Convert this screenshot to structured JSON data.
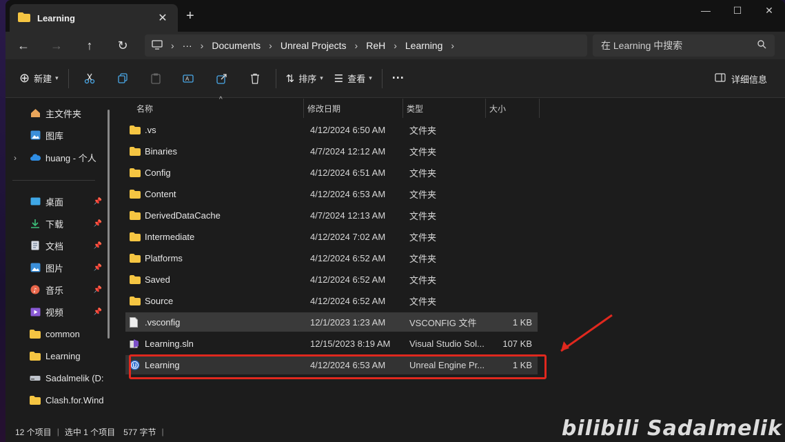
{
  "tab": {
    "title": "Learning"
  },
  "window_controls": {
    "minimize": "—",
    "maximize": "☐",
    "close": "✕"
  },
  "breadcrumb": [
    "Documents",
    "Unreal Projects",
    "ReH",
    "Learning"
  ],
  "search": {
    "placeholder": "在 Learning 中搜索"
  },
  "toolbar": {
    "new_label": "新建",
    "sort_label": "排序",
    "view_label": "查看",
    "details_label": "详细信息"
  },
  "sidebar": {
    "top": [
      {
        "label": "主文件夹",
        "icon": "home-icon"
      },
      {
        "label": "图库",
        "icon": "gallery-icon"
      },
      {
        "label": "huang - 个人",
        "icon": "cloud-icon"
      }
    ],
    "pinned": [
      {
        "label": "桌面",
        "icon": "desktop-icon"
      },
      {
        "label": "下载",
        "icon": "download-icon"
      },
      {
        "label": "文档",
        "icon": "documents-icon"
      },
      {
        "label": "图片",
        "icon": "pictures-icon"
      },
      {
        "label": "音乐",
        "icon": "music-icon"
      },
      {
        "label": "视频",
        "icon": "videos-icon"
      },
      {
        "label": "common",
        "icon": "folder-icon"
      },
      {
        "label": "Learning",
        "icon": "folder-icon"
      },
      {
        "label": "Sadalmelik (D:",
        "icon": "drive-icon"
      },
      {
        "label": "Clash.for.Wind",
        "icon": "folder-icon"
      }
    ]
  },
  "columns": {
    "name": "名称",
    "date": "修改日期",
    "type": "类型",
    "size": "大小"
  },
  "files": [
    {
      "name": ".vs",
      "date": "4/12/2024 6:50 AM",
      "type": "文件夹",
      "size": "",
      "icon": "folder-icon"
    },
    {
      "name": "Binaries",
      "date": "4/7/2024 12:12 AM",
      "type": "文件夹",
      "size": "",
      "icon": "folder-icon"
    },
    {
      "name": "Config",
      "date": "4/12/2024 6:51 AM",
      "type": "文件夹",
      "size": "",
      "icon": "folder-icon"
    },
    {
      "name": "Content",
      "date": "4/12/2024 6:53 AM",
      "type": "文件夹",
      "size": "",
      "icon": "folder-icon"
    },
    {
      "name": "DerivedDataCache",
      "date": "4/7/2024 12:13 AM",
      "type": "文件夹",
      "size": "",
      "icon": "folder-icon"
    },
    {
      "name": "Intermediate",
      "date": "4/12/2024 7:02 AM",
      "type": "文件夹",
      "size": "",
      "icon": "folder-icon"
    },
    {
      "name": "Platforms",
      "date": "4/12/2024 6:52 AM",
      "type": "文件夹",
      "size": "",
      "icon": "folder-icon"
    },
    {
      "name": "Saved",
      "date": "4/12/2024 6:52 AM",
      "type": "文件夹",
      "size": "",
      "icon": "folder-icon"
    },
    {
      "name": "Source",
      "date": "4/12/2024 6:52 AM",
      "type": "文件夹",
      "size": "",
      "icon": "folder-icon"
    },
    {
      "name": ".vsconfig",
      "date": "12/1/2023 1:23 AM",
      "type": "VSCONFIG 文件",
      "size": "1 KB",
      "icon": "file-icon"
    },
    {
      "name": "Learning.sln",
      "date": "12/15/2023 8:19 AM",
      "type": "Visual Studio Sol...",
      "size": "107 KB",
      "icon": "vs-solution-icon"
    },
    {
      "name": "Learning",
      "date": "4/12/2024 6:53 AM",
      "type": "Unreal Engine Pr...",
      "size": "1 KB",
      "icon": "unreal-engine-icon"
    }
  ],
  "status": {
    "count": "12 个项目",
    "selected": "选中 1 个项目",
    "size": "577 字节"
  },
  "watermark": "bilibili Sadalmelik",
  "colors": {
    "folder": "#f5c542",
    "highlight": "#e0281e"
  }
}
